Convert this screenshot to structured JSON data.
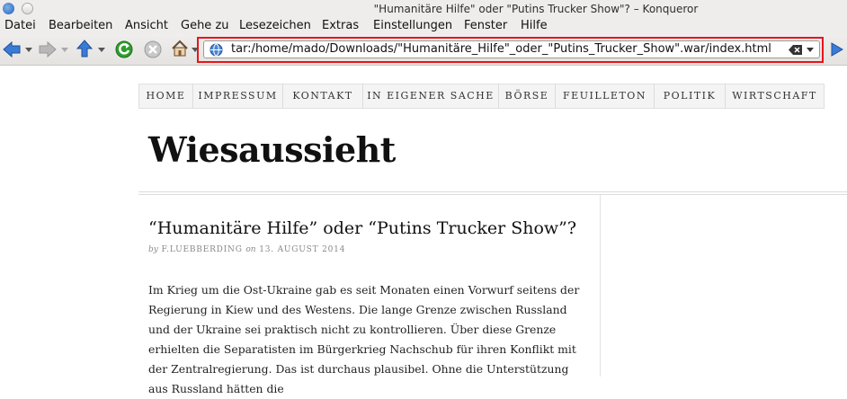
{
  "window": {
    "title": "\"Humanitäre Hilfe\" oder \"Putins Trucker Show\"? – Konqueror"
  },
  "menubar": {
    "items": [
      "Datei",
      "Bearbeiten",
      "Ansicht",
      "Gehe zu",
      "Lesezeichen",
      "Extras",
      "Einstellungen",
      "Fenster",
      "Hilfe"
    ]
  },
  "toolbar": {
    "url": "tar:/home/mado/Downloads/\"Humanitäre_Hilfe\"_oder_\"Putins_Trucker_Show\".war/index.html"
  },
  "page": {
    "nav": [
      "HOME",
      "IMPRESSUM",
      "KONTAKT",
      "IN EIGENER SACHE",
      "BÖRSE",
      "FEUILLETON",
      "POLITIK",
      "WIRTSCHAFT"
    ],
    "site_title": "Wiesaussieht",
    "post": {
      "title": "“Humanitäre Hilfe” oder “Putins Trucker Show”?",
      "by": "by",
      "author": "F.LUEBBERDING",
      "on": "on",
      "date": "13. AUGUST 2014",
      "body": "Im Krieg um die Ost-Ukraine gab es seit Monaten einen Vorwurf seitens der Regierung in Kiew und des Westens. Die lange Grenze zwischen Russland und der Ukraine sei praktisch nicht zu kontrollieren. Über diese Grenze erhielten die Separatisten im Bürgerkrieg Nachschub für ihren Konflikt mit der Zentralregierung. Das ist durchaus plausibel. Ohne die Unterstützung aus Russland hätten die"
    }
  },
  "colors": {
    "highlight": "#e8141b",
    "chrome": "#eeedec",
    "nav_bg": "#f4f4f4"
  }
}
